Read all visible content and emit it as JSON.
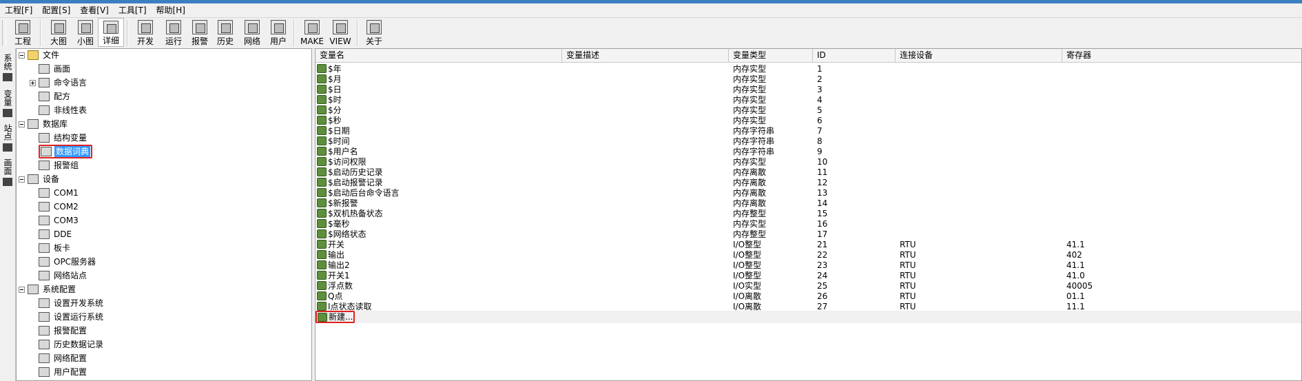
{
  "menubar": [
    "工程[F]",
    "配置[S]",
    "查看[V]",
    "工具[T]",
    "帮助[H]"
  ],
  "toolbar": [
    {
      "label": "工程",
      "icon": "project-icon"
    },
    {
      "label": "大图",
      "icon": "large-icons-icon"
    },
    {
      "label": "小图",
      "icon": "small-icons-icon"
    },
    {
      "label": "详细",
      "icon": "details-icon",
      "active": true
    },
    {
      "label": "开发",
      "icon": "develop-icon"
    },
    {
      "label": "运行",
      "icon": "run-icon"
    },
    {
      "label": "报警",
      "icon": "alarm-icon"
    },
    {
      "label": "历史",
      "icon": "history-icon"
    },
    {
      "label": "网络",
      "icon": "network-icon"
    },
    {
      "label": "用户",
      "icon": "user-icon"
    },
    {
      "label": "MAKE",
      "icon": "make-icon"
    },
    {
      "label": "VIEW",
      "icon": "view-icon"
    },
    {
      "label": "关于",
      "icon": "about-icon"
    }
  ],
  "side_tabs": [
    "系统",
    "变量",
    "站点",
    "画面"
  ],
  "tree": [
    {
      "label": "文件",
      "level": 0,
      "expander": "minus",
      "icon": "folder-icon"
    },
    {
      "label": "画面",
      "level": 1,
      "icon": "screen-icon"
    },
    {
      "label": "命令语言",
      "level": 1,
      "expander": "plus",
      "icon": "command-language-icon"
    },
    {
      "label": "配方",
      "level": 1,
      "icon": "recipe-icon"
    },
    {
      "label": "非线性表",
      "level": 1,
      "icon": "nonlinear-table-icon"
    },
    {
      "label": "数据库",
      "level": 0,
      "expander": "minus",
      "icon": "database-icon"
    },
    {
      "label": "结构变量",
      "level": 1,
      "icon": "struct-variable-icon"
    },
    {
      "label": "数据词典",
      "level": 1,
      "icon": "data-dictionary-icon",
      "selected": true,
      "highlight": true
    },
    {
      "label": "报警组",
      "level": 1,
      "icon": "alarm-group-icon"
    },
    {
      "label": "设备",
      "level": 0,
      "expander": "minus",
      "icon": "device-icon"
    },
    {
      "label": "COM1",
      "level": 1,
      "icon": "com-port-icon"
    },
    {
      "label": "COM2",
      "level": 1,
      "icon": "com-port-icon"
    },
    {
      "label": "COM3",
      "level": 1,
      "icon": "com-port-icon"
    },
    {
      "label": "DDE",
      "level": 1,
      "icon": "dde-icon"
    },
    {
      "label": "板卡",
      "level": 1,
      "icon": "board-card-icon"
    },
    {
      "label": "OPC服务器",
      "level": 1,
      "icon": "opc-server-icon"
    },
    {
      "label": "网络站点",
      "level": 1,
      "icon": "network-station-icon"
    },
    {
      "label": "系统配置",
      "level": 0,
      "expander": "minus",
      "icon": "tools-icon"
    },
    {
      "label": "设置开发系统",
      "level": 1,
      "icon": "dev-system-settings-icon"
    },
    {
      "label": "设置运行系统",
      "level": 1,
      "icon": "run-system-settings-icon"
    },
    {
      "label": "报警配置",
      "level": 1,
      "icon": "alarm-config-icon"
    },
    {
      "label": "历史数据记录",
      "level": 1,
      "icon": "history-record-icon"
    },
    {
      "label": "网络配置",
      "level": 1,
      "icon": "network-config-icon"
    },
    {
      "label": "用户配置",
      "level": 1,
      "icon": "user-config-icon"
    }
  ],
  "grid": {
    "columns": [
      "变量名",
      "变量描述",
      "变量类型",
      "ID",
      "连接设备",
      "寄存器"
    ],
    "rows": [
      [
        "$年",
        "",
        "内存实型",
        "1",
        "",
        ""
      ],
      [
        "$月",
        "",
        "内存实型",
        "2",
        "",
        ""
      ],
      [
        "$日",
        "",
        "内存实型",
        "3",
        "",
        ""
      ],
      [
        "$时",
        "",
        "内存实型",
        "4",
        "",
        ""
      ],
      [
        "$分",
        "",
        "内存实型",
        "5",
        "",
        ""
      ],
      [
        "$秒",
        "",
        "内存实型",
        "6",
        "",
        ""
      ],
      [
        "$日期",
        "",
        "内存字符串",
        "7",
        "",
        ""
      ],
      [
        "$时间",
        "",
        "内存字符串",
        "8",
        "",
        ""
      ],
      [
        "$用户名",
        "",
        "内存字符串",
        "9",
        "",
        ""
      ],
      [
        "$访问权限",
        "",
        "内存实型",
        "10",
        "",
        ""
      ],
      [
        "$启动历史记录",
        "",
        "内存离散",
        "11",
        "",
        ""
      ],
      [
        "$启动报警记录",
        "",
        "内存离散",
        "12",
        "",
        ""
      ],
      [
        "$启动后台命令语言",
        "",
        "内存离散",
        "13",
        "",
        ""
      ],
      [
        "$新报警",
        "",
        "内存离散",
        "14",
        "",
        ""
      ],
      [
        "$双机热备状态",
        "",
        "内存整型",
        "15",
        "",
        ""
      ],
      [
        "$毫秒",
        "",
        "内存实型",
        "16",
        "",
        ""
      ],
      [
        "$网络状态",
        "",
        "内存整型",
        "17",
        "",
        ""
      ],
      [
        "开关",
        "",
        "I/O整型",
        "21",
        "RTU",
        "41.1"
      ],
      [
        "输出",
        "",
        "I/O整型",
        "22",
        "RTU",
        "402"
      ],
      [
        "输出2",
        "",
        "I/O整型",
        "23",
        "RTU",
        "41.1"
      ],
      [
        "开关1",
        "",
        "I/O整型",
        "24",
        "RTU",
        "41.0"
      ],
      [
        "浮点数",
        "",
        "I/O实型",
        "25",
        "RTU",
        "40005"
      ],
      [
        "Q点",
        "",
        "I/O离散",
        "26",
        "RTU",
        "01.1"
      ],
      [
        "I点状态读取",
        "",
        "I/O离散",
        "27",
        "RTU",
        "11.1"
      ]
    ],
    "new_label": "新建..."
  }
}
